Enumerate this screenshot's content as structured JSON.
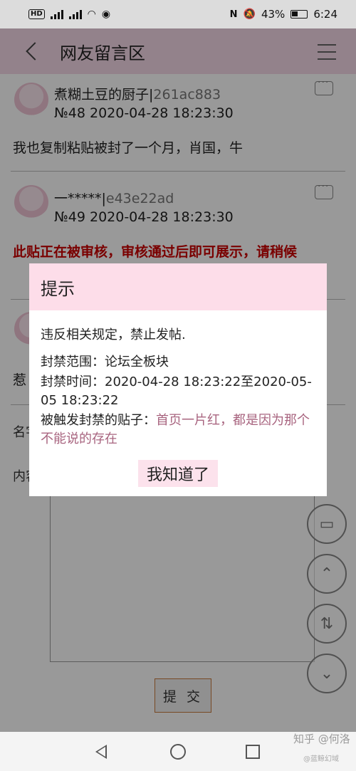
{
  "status_bar": {
    "hd_label": "HD",
    "battery": "43%",
    "time": "6:24"
  },
  "header": {
    "title": "网友留言区",
    "back_icon": "chevron-left-icon",
    "menu_icon": "hamburger-icon"
  },
  "posts": [
    {
      "user_name": "煮糊土豆的厨子|",
      "user_id": "261ac883",
      "meta": "№48  2020-04-28 18:23:30",
      "body": "我也复制粘贴被封了一个月，肖国，牛"
    },
    {
      "user_name": "一*****|",
      "user_id": "e43e22ad",
      "meta": "№49  2020-04-28 18:23:30",
      "body": ""
    }
  ],
  "review_notice": "此贴正在被审核，审核通过后即可展示，请稍候",
  "partial_post_text": "惹",
  "form": {
    "name_label": "名字",
    "content_label": "内容",
    "submit_label": "提 交"
  },
  "dialog": {
    "title": "提示",
    "message": "违反相关规定，禁止发帖.",
    "scope_label": "封禁范围：",
    "scope_value": "论坛全板块",
    "time_label": "封禁时间：",
    "time_value": "2020-04-28 18:23:22至2020-05-05 18:23:22",
    "trigger_label": "被触发封禁的贴子：",
    "trigger_value": "首页一片红，都是因为那个不能说的存在",
    "ok_label": "我知道了"
  },
  "floating_buttons": [
    "comment-icon",
    "scroll-top-icon",
    "refresh-icon",
    "scroll-bottom-icon"
  ],
  "watermark": {
    "text": "知乎 @何洛",
    "sub": "@蓝鲸幻域"
  },
  "colors": {
    "header_bg": "#f5d9e8",
    "dialog_header_bg": "#fddde9",
    "notice_red": "#cc0000",
    "link_mauve": "#a8647f"
  }
}
